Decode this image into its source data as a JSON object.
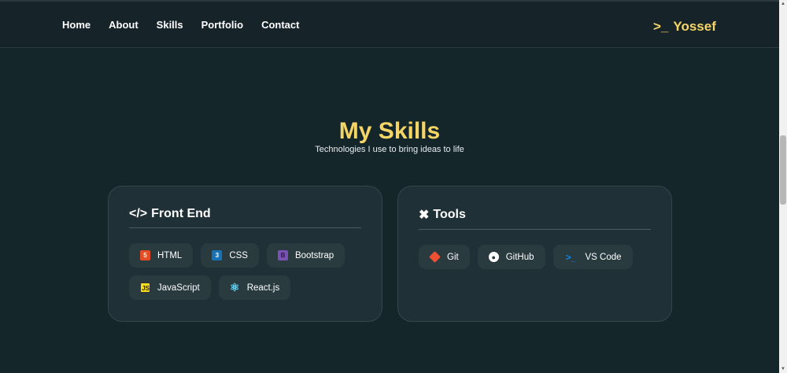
{
  "nav": {
    "links": [
      "Home",
      "About",
      "Skills",
      "Portfolio",
      "Contact"
    ],
    "logo": "Yossef",
    "logo_prompt": ">_"
  },
  "section": {
    "title": "My Skills",
    "subtitle": "Technologies I use to bring ideas to life"
  },
  "cards": [
    {
      "title": "Front End",
      "icon": "code-icon",
      "items": [
        {
          "label": "HTML",
          "icon": "html5-icon",
          "color": "#e44d26"
        },
        {
          "label": "CSS",
          "icon": "css3-icon",
          "color": "#1572b6"
        },
        {
          "label": "Bootstrap",
          "icon": "bootstrap-icon",
          "color": "#7952b3"
        },
        {
          "label": "JavaScript",
          "icon": "javascript-icon",
          "color": "#f7df1e"
        },
        {
          "label": "React.js",
          "icon": "react-icon",
          "color": "#61dafb"
        }
      ]
    },
    {
      "title": "Tools",
      "icon": "tools-icon",
      "items": [
        {
          "label": "Git",
          "icon": "git-icon",
          "color": "#f05032"
        },
        {
          "label": "GitHub",
          "icon": "github-icon",
          "color": "#ffffff"
        },
        {
          "label": "VS Code",
          "icon": "vscode-icon",
          "color": "#0a84e0"
        }
      ]
    }
  ],
  "colors": {
    "accent": "#f5d565",
    "background": "#15262b",
    "card": "#1f3137"
  }
}
